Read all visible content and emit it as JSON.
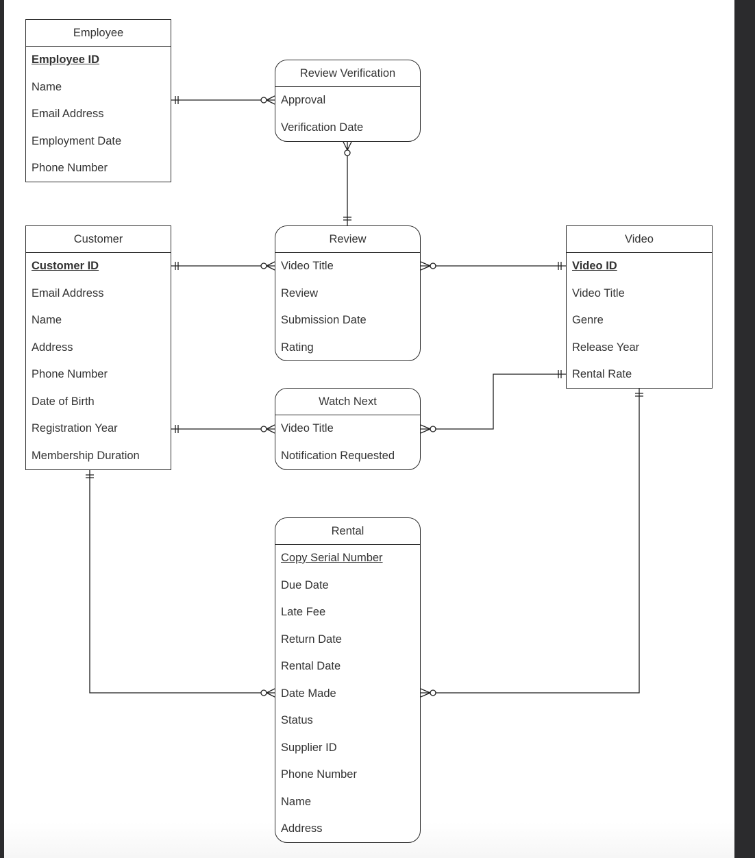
{
  "diagram": {
    "type": "entity-relationship",
    "entities": [
      {
        "id": "employee",
        "title": "Employee",
        "shape": "rectangle",
        "attributes": [
          {
            "name": "Employee ID",
            "key": "primary"
          },
          {
            "name": "Name"
          },
          {
            "name": "Email Address"
          },
          {
            "name": "Employment Date"
          },
          {
            "name": "Phone Number"
          }
        ]
      },
      {
        "id": "review_verification",
        "title": "Review Verification",
        "shape": "rounded",
        "attributes": [
          {
            "name": "Approval"
          },
          {
            "name": "Verification Date"
          }
        ]
      },
      {
        "id": "customer",
        "title": "Customer",
        "shape": "rectangle",
        "attributes": [
          {
            "name": "Customer ID",
            "key": "primary"
          },
          {
            "name": "Email Address"
          },
          {
            "name": "Name"
          },
          {
            "name": "Address"
          },
          {
            "name": "Phone Number"
          },
          {
            "name": "Date of Birth"
          },
          {
            "name": "Registration Year"
          },
          {
            "name": "Membership Duration"
          }
        ]
      },
      {
        "id": "review",
        "title": "Review",
        "shape": "rounded",
        "attributes": [
          {
            "name": "Video Title"
          },
          {
            "name": "Review"
          },
          {
            "name": "Submission Date"
          },
          {
            "name": "Rating"
          }
        ]
      },
      {
        "id": "video",
        "title": "Video",
        "shape": "rectangle",
        "attributes": [
          {
            "name": "Video ID",
            "key": "primary"
          },
          {
            "name": "Video Title"
          },
          {
            "name": "Genre"
          },
          {
            "name": "Release Year"
          },
          {
            "name": "Rental Rate"
          }
        ]
      },
      {
        "id": "watch_next",
        "title": "Watch Next",
        "shape": "rounded",
        "attributes": [
          {
            "name": "Video Title"
          },
          {
            "name": "Notification Requested"
          }
        ]
      },
      {
        "id": "rental",
        "title": "Rental",
        "shape": "rounded",
        "attributes": [
          {
            "name": "Copy Serial Number",
            "key": "partial"
          },
          {
            "name": "Due Date"
          },
          {
            "name": "Late Fee"
          },
          {
            "name": "Return Date"
          },
          {
            "name": "Rental Date"
          },
          {
            "name": "Date Made"
          },
          {
            "name": "Status"
          },
          {
            "name": "Supplier ID"
          },
          {
            "name": "Phone Number"
          },
          {
            "name": "Name"
          },
          {
            "name": "Address"
          }
        ]
      }
    ],
    "relationships": [
      {
        "from": "employee",
        "from_cardinality": "one-and-only-one",
        "to": "review_verification",
        "to_cardinality": "zero-or-many"
      },
      {
        "from": "review",
        "from_cardinality": "one-and-only-one",
        "to": "review_verification",
        "to_cardinality": "zero-or-many"
      },
      {
        "from": "customer",
        "from_cardinality": "one-and-only-one",
        "to": "review",
        "to_cardinality": "zero-or-many"
      },
      {
        "from": "video",
        "from_cardinality": "one-and-only-one",
        "to": "review",
        "to_cardinality": "zero-or-many"
      },
      {
        "from": "customer",
        "from_cardinality": "one-and-only-one",
        "to": "watch_next",
        "to_cardinality": "zero-or-many"
      },
      {
        "from": "video",
        "from_cardinality": "one-and-only-one",
        "to": "watch_next",
        "to_cardinality": "zero-or-many"
      },
      {
        "from": "customer",
        "from_cardinality": "one-and-only-one",
        "to": "rental",
        "to_cardinality": "zero-or-many"
      },
      {
        "from": "video",
        "from_cardinality": "one-and-only-one",
        "to": "rental",
        "to_cardinality": "zero-or-many"
      }
    ]
  }
}
